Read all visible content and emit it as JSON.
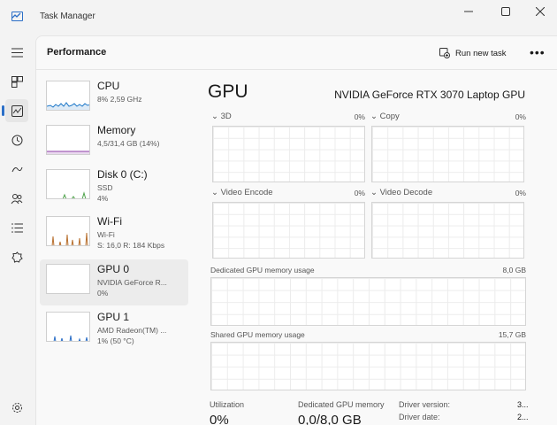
{
  "window": {
    "title": "Task Manager"
  },
  "header": {
    "title": "Performance",
    "run_new_task": "Run new task",
    "more": "•••"
  },
  "devices": [
    {
      "name": "CPU",
      "line1": "8% 2,59 GHz",
      "line2": "",
      "line3": ""
    },
    {
      "name": "Memory",
      "line1": "4,5/31,4 GB (14%)",
      "line2": "",
      "line3": ""
    },
    {
      "name": "Disk 0 (C:)",
      "line1": "SSD",
      "line2": "4%",
      "line3": ""
    },
    {
      "name": "Wi-Fi",
      "line1": "Wi-Fi",
      "line2": "S: 16,0  R: 184 Kbps",
      "line3": ""
    },
    {
      "name": "GPU 0",
      "line1": "NVIDIA GeForce R...",
      "line2": "0%",
      "line3": ""
    },
    {
      "name": "GPU 1",
      "line1": "AMD Radeon(TM) ...",
      "line2": "1% (50 °C)",
      "line3": ""
    }
  ],
  "gpu": {
    "title": "GPU",
    "model": "NVIDIA GeForce RTX 3070 Laptop GPU",
    "engines": [
      {
        "label": "3D",
        "value": "0%"
      },
      {
        "label": "Copy",
        "value": "0%"
      },
      {
        "label": "Video Encode",
        "value": "0%"
      },
      {
        "label": "Video Decode",
        "value": "0%"
      }
    ],
    "dedicated": {
      "label": "Dedicated GPU memory usage",
      "value": "8,0 GB"
    },
    "shared": {
      "label": "Shared GPU memory usage",
      "value": "15,7 GB"
    },
    "stats": {
      "utilization_label": "Utilization",
      "utilization_value": "0%",
      "dedicated_label": "Dedicated GPU memory",
      "dedicated_value": "0,0/8,0 GB"
    },
    "driver": {
      "version_label": "Driver version:",
      "version_value": "3...",
      "date_label": "Driver date:",
      "date_value": "2..."
    }
  },
  "colors": {
    "accent": "#2b6fc7",
    "cpu": "#1f79c9",
    "memory": "#8f3fa8",
    "disk": "#4ea24a",
    "wifi": "#b8702f",
    "gpu": "#2b6fc7"
  }
}
